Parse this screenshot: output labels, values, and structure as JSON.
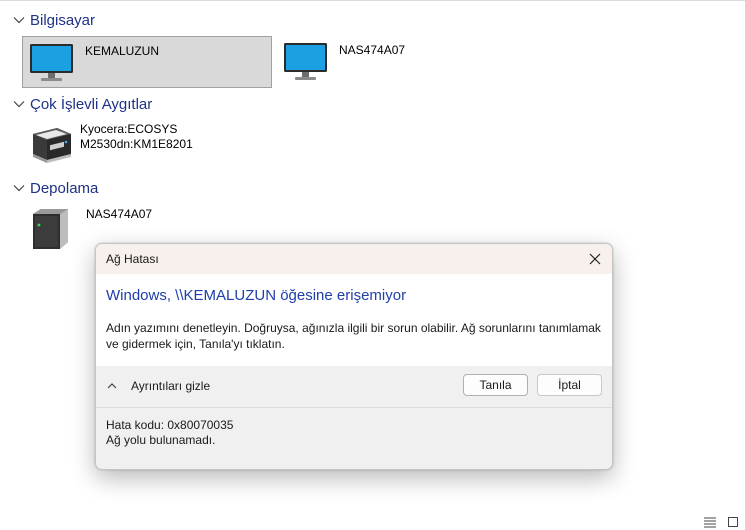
{
  "groups": [
    {
      "title": "Bilgisayar",
      "items": [
        {
          "label": "KEMALUZUN",
          "icon": "monitor-icon",
          "selected": true
        },
        {
          "label": "NAS474A07",
          "icon": "monitor-icon",
          "selected": false
        }
      ]
    },
    {
      "title": "Çok İşlevli Aygıtlar",
      "items": [
        {
          "label_line1": "Kyocera:ECOSYS",
          "label_line2": "M2530dn:KM1E8201",
          "icon": "printer-icon"
        }
      ]
    },
    {
      "title": "Depolama",
      "items": [
        {
          "label": "NAS474A07",
          "icon": "storage-drive-icon"
        }
      ]
    }
  ],
  "dialog": {
    "title": "Ağ Hatası",
    "heading": "Windows, \\\\KEMALUZUN öğesine erişemiyor",
    "message": "Adın yazımını denetleyin. Doğruysa, ağınızla ilgili bir sorun olabilir. Ağ sorunlarını tanımlamak ve gidermek için, Tanıla'yı tıklatın.",
    "toggle_details_label": "Ayrıntıları gizle",
    "diagnose_label": "Tanıla",
    "cancel_label": "İptal",
    "error_code": "Hata kodu: 0x80070035",
    "error_text": "Ağ yolu bulunamadı."
  },
  "colors": {
    "group_title": "#1e3287",
    "dialog_heading": "#1e3eaa",
    "selection_bg": "#d9d9d9",
    "monitor_screen": "#1ba1e2"
  },
  "statusbar": {
    "icons": [
      "details-view-icon",
      "large-icons-view-icon"
    ]
  }
}
